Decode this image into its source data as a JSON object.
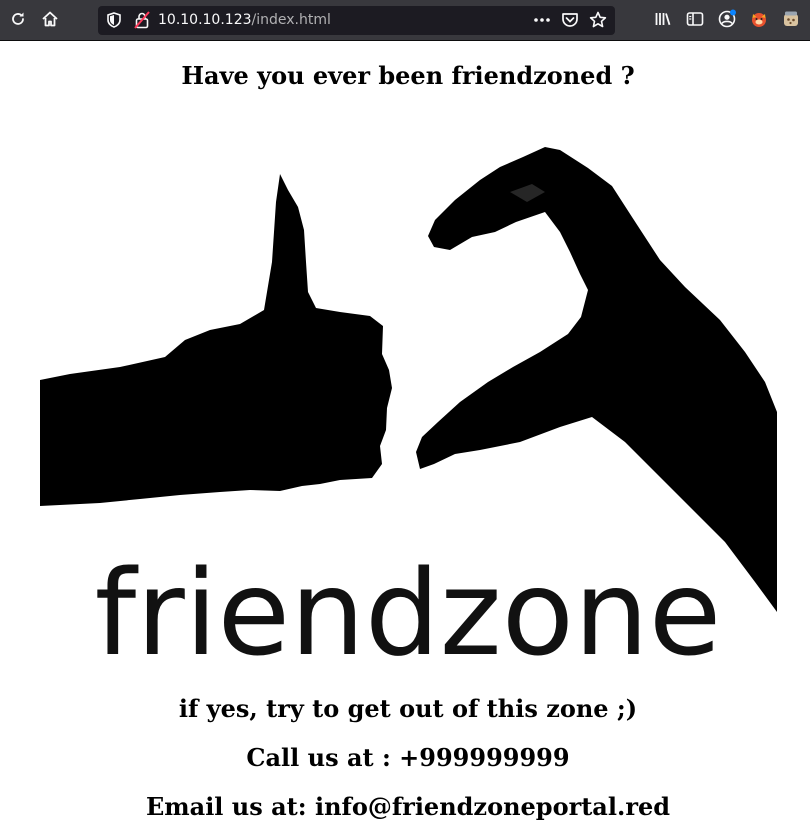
{
  "browser": {
    "url_host": "10.10.10.123",
    "url_path": "/index.html",
    "icons": {
      "reload": "reload-icon",
      "home": "home-icon",
      "tracking": "shield-icon",
      "insecure": "insecure-lock-icon",
      "page_actions": "more-actions-icon",
      "pocket": "pocket-icon",
      "bookmark": "star-icon",
      "library": "library-icon",
      "sidebar": "sidebar-icon",
      "account": "account-icon",
      "extension1": "extension-fox-icon",
      "extension2": "extension-cookie-icon"
    }
  },
  "page": {
    "heading": "Have you ever been friendzoned ?",
    "logo_word": "friendzone",
    "line1": "if yes, try to get out of this zone ;)",
    "line2": "Call us at : +999999999",
    "line3": "Email us at: info@friendzoneportal.red"
  },
  "colors": {
    "toolbar_bg": "#38383d",
    "urlbar_bg": "#1c1b22",
    "page_bg": "#ffffff",
    "text": "#000000"
  }
}
